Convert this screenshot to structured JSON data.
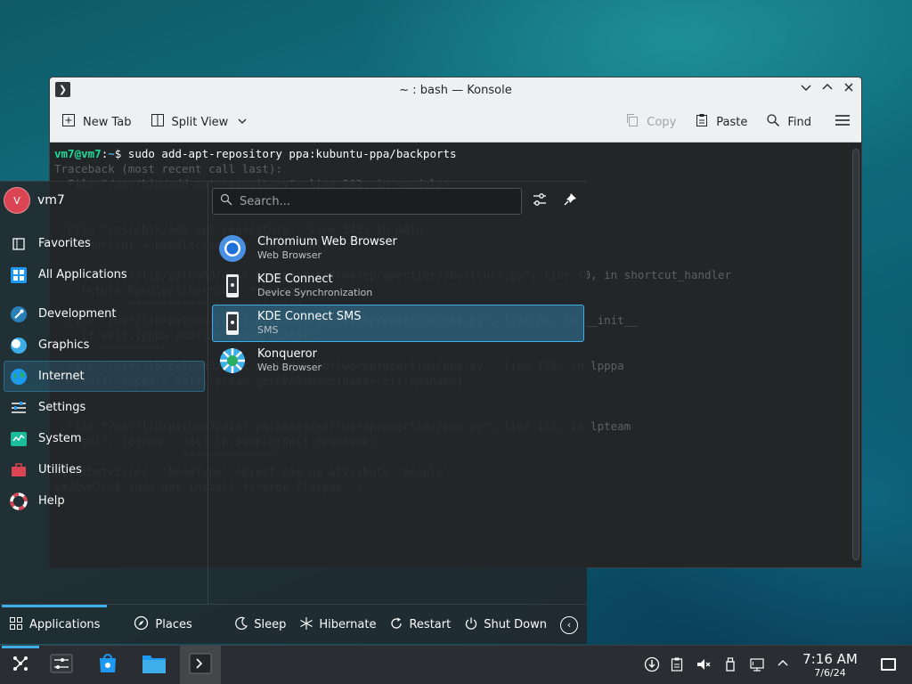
{
  "colors": {
    "accent": "#3daee9",
    "panel": "#2a2e32",
    "window_chrome": "#eff0f1",
    "terminal_bg": "#232627"
  },
  "konsole": {
    "title": "~ : bash — Konsole",
    "toolbar": {
      "new_tab": "New Tab",
      "split_view": "Split View",
      "copy": "Copy",
      "paste": "Paste",
      "find": "Find"
    },
    "terminal": {
      "prompt_user": "vm7@vm7",
      "prompt_path": "~",
      "command": "$ sudo add-apt-repository ppa:kubuntu-ppa/backports",
      "lines": [
        "Traceback (most recent call last):",
        "  File \"/usr/bin/add-apt-repository\", line 362, in <module>",
        "",
        "",
        "  File \"/usr/bin/add-apt-repository\", line 345, in main",
        "    shortcut = handler(source, login_only)",
        "",
        "  File \"/usr/lib/python3/dist-packages/softwareproperties/shortcuts.py\", line 40, in shortcut_handler",
        "    return handler(shortcut, **kwargs)",
        "           ^^^^^^^^^^^^^^^^^^^^^^^^^^",
        "  File \"/usr/lib/python3/dist-packages/softwareproperties/ppa.py\", line 86, in __init__",
        "    if self.lpppa.publish_debug_symbols:",
        "       ^^^^^^^^^^",
        "  File \"/usr/lib/python3/dist-packages/softwareproperties/ppa.py\", line 126, in lpppa",
        "    self._lpppa = self.lpteam.getPPAByName(name=self.ppaname)",
        "",
        "",
        "  File \"/usr/lib/python3/dist-packages/softwareproperties/ppa.py\", line 111, in lpteam",
        "    self._lpteam = self.lp.people(self.teamname)",
        "                   ^^^^^^^^^^^^^^",
        "AttributeError: 'NoneType' object has no attribute 'people'",
        "vm7@vm7:~$ sudo apt install firefox flatpak -y"
      ]
    }
  },
  "launcher": {
    "user": {
      "initial": "V",
      "name": "vm7"
    },
    "search_placeholder": "Search...",
    "categories": [
      {
        "label": "Favorites",
        "icon": "star-icon"
      },
      {
        "label": "All Applications",
        "icon": "grid-icon"
      },
      {
        "label": "Development",
        "icon": "development-icon"
      },
      {
        "label": "Graphics",
        "icon": "graphics-icon"
      },
      {
        "label": "Internet",
        "icon": "globe-icon"
      },
      {
        "label": "Settings",
        "icon": "settings-icon"
      },
      {
        "label": "System",
        "icon": "system-icon"
      },
      {
        "label": "Utilities",
        "icon": "utilities-icon"
      },
      {
        "label": "Help",
        "icon": "help-icon"
      }
    ],
    "active_category": "Internet",
    "apps": [
      {
        "name": "Chromium Web Browser",
        "desc": "Web Browser",
        "icon": "chromium-icon"
      },
      {
        "name": "KDE Connect",
        "desc": "Device Synchronization",
        "icon": "kdeconnect-icon"
      },
      {
        "name": "KDE Connect SMS",
        "desc": "SMS",
        "icon": "kdeconnect-sms-icon"
      },
      {
        "name": "Konqueror",
        "desc": "Web Browser",
        "icon": "konqueror-icon"
      }
    ],
    "footer": {
      "tab_applications": "Applications",
      "tab_places": "Places",
      "sleep": "Sleep",
      "hibernate": "Hibernate",
      "restart": "Restart",
      "shutdown": "Shut Down"
    }
  },
  "taskbar": {
    "clock": {
      "time": "7:16 AM",
      "date": "7/6/24"
    }
  }
}
